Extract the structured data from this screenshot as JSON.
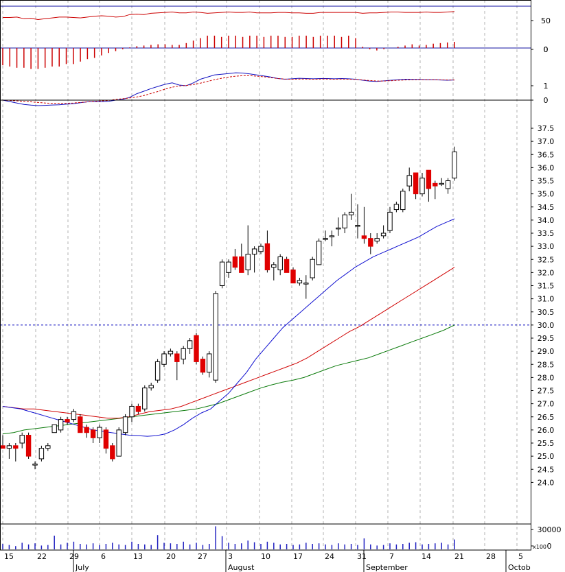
{
  "chart_data": {
    "type": "candlestick",
    "x_axis": {
      "day_labels": [
        "15",
        "22",
        "29",
        "6",
        "13",
        "20",
        "27",
        "3",
        "10",
        "17",
        "24",
        "31",
        "7",
        "14",
        "21",
        "28",
        "5"
      ],
      "month_labels": [
        "July",
        "August",
        "September",
        "Octob"
      ]
    },
    "rsi_panel": {
      "y_ticks": [
        "50",
        "0"
      ],
      "values": [
        73,
        73,
        74,
        70,
        71,
        68,
        70,
        72,
        74,
        74,
        73,
        72,
        74,
        76,
        77,
        76,
        74,
        75,
        80,
        81,
        80,
        83,
        84,
        85,
        86,
        84,
        84,
        86,
        85,
        83,
        84,
        85,
        86,
        85,
        85,
        86,
        84,
        84,
        84,
        85,
        85,
        84,
        84,
        83,
        83,
        85,
        85,
        85,
        85,
        85,
        85,
        83,
        84,
        84,
        85,
        86,
        86,
        85,
        85,
        85,
        86,
        85,
        85,
        86,
        87
      ]
    },
    "histogram_panel": {
      "y_ticks": [
        "0"
      ],
      "values": [
        -0.28,
        -0.3,
        -0.32,
        -0.32,
        -0.34,
        -0.34,
        -0.32,
        -0.3,
        -0.3,
        -0.26,
        -0.26,
        -0.22,
        -0.18,
        -0.16,
        -0.12,
        -0.08,
        -0.05,
        -0.02,
        0.01,
        0.03,
        0.04,
        0.05,
        0.06,
        0.06,
        0.05,
        0.05,
        0.08,
        0.12,
        0.16,
        0.2,
        0.2,
        0.18,
        0.2,
        0.2,
        0.18,
        0.2,
        0.2,
        0.18,
        0.2,
        0.2,
        0.18,
        0.18,
        0.2,
        0.2,
        0.18,
        0.2,
        0.2,
        0.2,
        0.18,
        0.2,
        0.16,
        0.02,
        -0.02,
        -0.04,
        -0.02,
        0.0,
        0.02,
        0.04,
        0.06,
        0.04,
        0.05,
        0.07,
        0.08,
        0.09,
        0.1
      ]
    },
    "macd_panel": {
      "y_ticks": [
        "1",
        "0"
      ],
      "macd": [
        0.0,
        -0.1,
        -0.2,
        -0.3,
        -0.35,
        -0.38,
        -0.36,
        -0.34,
        -0.32,
        -0.28,
        -0.25,
        -0.18,
        -0.12,
        -0.1,
        -0.12,
        -0.08,
        0.0,
        0.05,
        0.2,
        0.45,
        0.62,
        0.8,
        0.95,
        1.1,
        1.2,
        1.05,
        1.0,
        1.2,
        1.45,
        1.6,
        1.75,
        1.8,
        1.85,
        1.9,
        1.88,
        1.82,
        1.75,
        1.68,
        1.6,
        1.5,
        1.45,
        1.48,
        1.52,
        1.5,
        1.48,
        1.5,
        1.5,
        1.48,
        1.5,
        1.48,
        1.45,
        1.38,
        1.32,
        1.3,
        1.34,
        1.38,
        1.42,
        1.45,
        1.44,
        1.44,
        1.42,
        1.42,
        1.4,
        1.38,
        1.4
      ],
      "signal": [
        0.0,
        -0.02,
        -0.05,
        -0.08,
        -0.12,
        -0.16,
        -0.2,
        -0.22,
        -0.22,
        -0.22,
        -0.2,
        -0.16,
        -0.12,
        -0.08,
        -0.05,
        -0.02,
        0.05,
        0.1,
        0.15,
        0.22,
        0.32,
        0.46,
        0.6,
        0.76,
        0.9,
        0.98,
        1.02,
        1.08,
        1.18,
        1.3,
        1.42,
        1.52,
        1.6,
        1.66,
        1.7,
        1.7,
        1.66,
        1.62,
        1.56,
        1.5,
        1.46,
        1.45,
        1.46,
        1.46,
        1.45,
        1.46,
        1.46,
        1.45,
        1.46,
        1.45,
        1.44,
        1.4,
        1.36,
        1.33,
        1.33,
        1.35,
        1.38,
        1.4,
        1.41,
        1.42,
        1.42,
        1.42,
        1.41,
        1.4,
        1.4
      ]
    },
    "price_panel": {
      "y_ticks": [
        "37.5",
        "37.0",
        "36.5",
        "36.0",
        "35.5",
        "35.0",
        "34.5",
        "34.0",
        "33.5",
        "33.0",
        "32.5",
        "32.0",
        "31.5",
        "31.0",
        "30.5",
        "30.0",
        "29.5",
        "29.0",
        "28.5",
        "28.0",
        "27.5",
        "27.0",
        "26.5",
        "26.0",
        "25.5",
        "25.0",
        "24.5",
        "24.0"
      ],
      "reference_line": 30.0,
      "candles": [
        [
          25.4,
          25.8,
          25.3,
          25.3
        ],
        [
          25.3,
          25.5,
          24.9,
          25.4
        ],
        [
          25.4,
          25.5,
          24.8,
          25.3
        ],
        [
          25.5,
          25.9,
          25.3,
          25.8
        ],
        [
          25.8,
          25.9,
          24.9,
          25.0
        ],
        [
          24.7,
          24.8,
          24.5,
          24.7
        ],
        [
          24.9,
          25.4,
          24.8,
          25.3
        ],
        [
          25.3,
          25.5,
          25.2,
          25.4
        ],
        [
          25.9,
          26.2,
          25.9,
          26.2
        ],
        [
          26.0,
          26.5,
          25.9,
          26.4
        ],
        [
          26.4,
          26.5,
          26.2,
          26.3
        ],
        [
          26.4,
          26.8,
          26.3,
          26.7
        ],
        [
          26.5,
          26.6,
          25.9,
          25.9
        ],
        [
          26.1,
          26.2,
          25.7,
          25.9
        ],
        [
          26.0,
          26.1,
          25.5,
          25.7
        ],
        [
          25.7,
          26.2,
          25.5,
          26.1
        ],
        [
          26.0,
          26.1,
          25.1,
          25.3
        ],
        [
          25.4,
          25.5,
          24.8,
          24.9
        ],
        [
          25.0,
          26.1,
          25.0,
          26.0
        ],
        [
          25.9,
          26.6,
          25.8,
          26.5
        ],
        [
          26.5,
          27.0,
          26.3,
          26.9
        ],
        [
          26.9,
          27.0,
          26.6,
          26.7
        ],
        [
          26.8,
          27.7,
          26.7,
          27.6
        ],
        [
          27.6,
          27.8,
          27.5,
          27.7
        ],
        [
          27.9,
          28.7,
          27.8,
          28.6
        ],
        [
          28.5,
          29.0,
          28.4,
          28.9
        ],
        [
          28.9,
          29.1,
          28.8,
          29.0
        ],
        [
          28.9,
          29.0,
          27.9,
          28.6
        ],
        [
          28.7,
          29.2,
          28.5,
          29.1
        ],
        [
          29.1,
          29.5,
          28.9,
          29.4
        ],
        [
          29.6,
          29.7,
          28.5,
          28.6
        ],
        [
          28.7,
          28.8,
          28.1,
          28.2
        ],
        [
          28.2,
          29.0,
          28.0,
          28.9
        ],
        [
          27.9,
          31.3,
          27.8,
          31.2
        ],
        [
          31.5,
          32.5,
          31.4,
          32.4
        ],
        [
          32.0,
          32.5,
          31.8,
          32.4
        ],
        [
          32.6,
          32.9,
          32.1,
          32.2
        ],
        [
          32.6,
          33.1,
          32.0,
          32.0
        ],
        [
          32.1,
          33.8,
          31.9,
          32.7
        ],
        [
          32.7,
          33.0,
          32.0,
          32.9
        ],
        [
          32.8,
          33.1,
          32.7,
          33.0
        ],
        [
          33.1,
          33.6,
          32.0,
          32.1
        ],
        [
          32.2,
          32.4,
          31.7,
          32.3
        ],
        [
          32.1,
          32.7,
          31.9,
          32.6
        ],
        [
          32.5,
          32.6,
          32.0,
          32.0
        ],
        [
          32.1,
          32.2,
          31.6,
          31.6
        ],
        [
          31.6,
          31.8,
          31.5,
          31.7
        ],
        [
          31.6,
          31.9,
          31.0,
          31.6
        ],
        [
          31.8,
          32.6,
          31.7,
          32.5
        ],
        [
          32.3,
          33.3,
          32.3,
          33.2
        ],
        [
          33.3,
          33.6,
          33.2,
          33.3
        ],
        [
          33.4,
          33.6,
          33.0,
          33.4
        ],
        [
          33.7,
          34.1,
          33.4,
          33.7
        ],
        [
          33.7,
          34.3,
          33.5,
          34.2
        ],
        [
          34.2,
          35.0,
          34.0,
          34.3
        ],
        [
          33.8,
          34.6,
          33.3,
          33.8
        ],
        [
          33.4,
          34.5,
          33.1,
          33.3
        ],
        [
          33.3,
          33.5,
          32.7,
          33.0
        ],
        [
          33.2,
          33.5,
          33.1,
          33.3
        ],
        [
          33.4,
          33.8,
          33.3,
          33.5
        ],
        [
          33.6,
          34.5,
          33.5,
          34.3
        ],
        [
          34.4,
          34.7,
          34.3,
          34.6
        ],
        [
          34.4,
          35.2,
          34.3,
          35.1
        ],
        [
          35.3,
          36.0,
          35.1,
          35.7
        ],
        [
          35.8,
          35.8,
          34.8,
          35.0
        ],
        [
          35.0,
          35.8,
          34.9,
          35.6
        ],
        [
          35.9,
          35.9,
          34.7,
          35.2
        ],
        [
          35.4,
          35.5,
          34.8,
          35.3
        ],
        [
          35.4,
          35.6,
          35.3,
          35.4
        ],
        [
          35.2,
          35.6,
          35.0,
          35.5
        ],
        [
          35.6,
          36.8,
          35.5,
          36.6
        ]
      ],
      "ma_blue": [
        26.9,
        26.85,
        26.8,
        26.7,
        26.6,
        26.5,
        26.4,
        26.3,
        26.2,
        26.1,
        26.0,
        25.95,
        25.9,
        25.85,
        25.8,
        25.78,
        25.76,
        25.78,
        25.85,
        26.0,
        26.2,
        26.45,
        26.65,
        26.8,
        27.1,
        27.4,
        27.8,
        28.2,
        28.7,
        29.1,
        29.5,
        29.9,
        30.2,
        30.5,
        30.8,
        31.1,
        31.4,
        31.7,
        31.95,
        32.2,
        32.4,
        32.6,
        32.75,
        32.9,
        33.05,
        33.2,
        33.35,
        33.55,
        33.75,
        33.9,
        34.05
      ],
      "ma_red": [
        26.9,
        26.85,
        26.8,
        26.8,
        26.75,
        26.7,
        26.65,
        26.6,
        26.55,
        26.5,
        26.45,
        26.45,
        26.5,
        26.6,
        26.7,
        26.75,
        26.8,
        26.9,
        27.05,
        27.2,
        27.35,
        27.5,
        27.65,
        27.8,
        27.95,
        28.1,
        28.25,
        28.4,
        28.55,
        28.75,
        29.0,
        29.25,
        29.5,
        29.75,
        29.95,
        30.2,
        30.45,
        30.7,
        30.95,
        31.2,
        31.45,
        31.7,
        31.95,
        32.2
      ],
      "ma_green": [
        25.85,
        25.9,
        26.0,
        26.05,
        26.1,
        26.15,
        26.2,
        26.25,
        26.3,
        26.35,
        26.4,
        26.45,
        26.5,
        26.55,
        26.6,
        26.65,
        26.7,
        26.75,
        26.8,
        26.9,
        27.0,
        27.15,
        27.3,
        27.45,
        27.6,
        27.72,
        27.82,
        27.9,
        28.0,
        28.15,
        28.3,
        28.45,
        28.55,
        28.65,
        28.75,
        28.9,
        29.05,
        29.2,
        29.35,
        29.5,
        29.65,
        29.8,
        30.0
      ]
    },
    "volume_panel": {
      "y_ticks": [
        "30000",
        "0"
      ],
      "multiplier_label": "x100",
      "values": [
        10,
        8,
        6,
        12,
        9,
        11,
        7,
        8,
        25,
        9,
        12,
        14,
        10,
        9,
        11,
        8,
        10,
        12,
        9,
        8,
        14,
        10,
        9,
        8,
        26,
        12,
        11,
        10,
        14,
        9,
        12,
        8,
        10,
        42,
        24,
        12,
        10,
        11,
        16,
        13,
        10,
        14,
        12,
        9,
        10,
        8,
        9,
        12,
        10,
        11,
        9,
        8,
        11,
        9,
        10,
        8,
        20,
        9,
        7,
        8,
        11,
        9,
        10,
        12,
        13,
        9,
        10,
        11,
        12,
        9,
        18
      ]
    }
  }
}
